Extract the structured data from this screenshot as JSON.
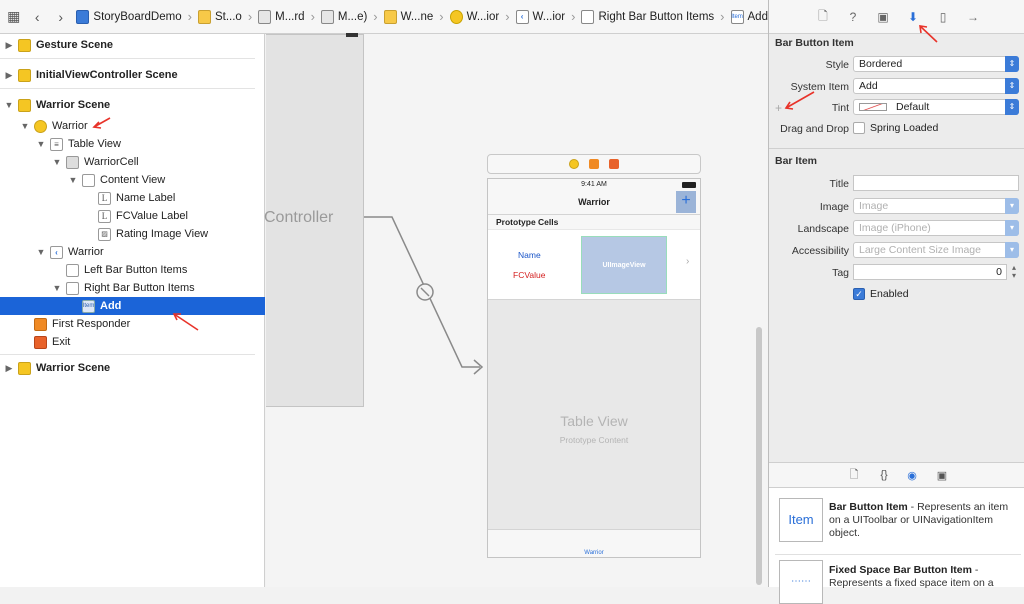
{
  "jumpbar": {
    "crumbs": [
      {
        "label": "StoryBoardDemo",
        "icon": "project-icon"
      },
      {
        "label": "St...o",
        "icon": "folder-icon"
      },
      {
        "label": "M...rd",
        "icon": "storyboard-icon"
      },
      {
        "label": "M...e)",
        "icon": "storyboard-icon"
      },
      {
        "label": "W...ne",
        "icon": "scene-icon"
      },
      {
        "label": "W...ior",
        "icon": "view-controller-icon"
      },
      {
        "label": "W...ior",
        "icon": "navigation-item-icon"
      },
      {
        "label": "Right Bar Button Items",
        "icon": "items-icon"
      },
      {
        "label": "Add",
        "icon": "bar-button-item-icon"
      }
    ]
  },
  "outline": {
    "rows": [
      {
        "label": "Gesture Scene",
        "bold": true
      },
      {
        "label": "InitialViewController Scene",
        "bold": true
      },
      {
        "label": "Warrior Scene",
        "bold": true
      },
      {
        "label": "Warrior"
      },
      {
        "label": "Table View"
      },
      {
        "label": "WarriorCell"
      },
      {
        "label": "Content View"
      },
      {
        "label": "Name Label"
      },
      {
        "label": "FCValue Label"
      },
      {
        "label": "Rating Image View"
      },
      {
        "label": "Warrior"
      },
      {
        "label": "Left Bar Button Items"
      },
      {
        "label": "Right Bar Button Items"
      },
      {
        "label": "Add",
        "selected": true
      },
      {
        "label": "First Responder"
      },
      {
        "label": "Exit"
      },
      {
        "label": "Warrior Scene",
        "bold": true
      }
    ]
  },
  "canvas": {
    "left_vc_title": "Controller",
    "scene": {
      "time": "9:41 AM",
      "nav_title": "Warrior",
      "add_glyph": "+",
      "section_header": "Prototype Cells",
      "name_label": "Name",
      "fc_label": "FCValue",
      "image_view": "UIImageView",
      "table_title": "Table View",
      "table_subtitle": "Prototype Content",
      "tab_label": "Warrior"
    }
  },
  "inspector": {
    "bar_button_item": {
      "title": "Bar Button Item",
      "style_label": "Style",
      "style_value": "Bordered",
      "system_item_label": "System Item",
      "system_item_value": "Add",
      "tint_label": "Tint",
      "tint_value": "Default",
      "drag_drop_label": "Drag and Drop",
      "spring_loaded_label": "Spring Loaded"
    },
    "bar_item": {
      "title": "Bar Item",
      "title_label": "Title",
      "title_value": "",
      "image_label": "Image",
      "image_placeholder": "Image",
      "landscape_label": "Landscape",
      "landscape_placeholder": "Image (iPhone)",
      "accessibility_label": "Accessibility",
      "accessibility_placeholder": "Large Content Size Image",
      "tag_label": "Tag",
      "tag_value": "0",
      "enabled_label": "Enabled",
      "enabled": true
    },
    "library": [
      {
        "icon_text": "Item",
        "title": "Bar Button Item",
        "desc": " - Represents an item on a UIToolbar or UINavigationItem object."
      },
      {
        "icon_text": "",
        "title": "Fixed Space Bar Button Item",
        "desc": " - Represents a fixed space item on a"
      }
    ]
  },
  "colors": {
    "selection": "#1b64d8",
    "accent": "#3b7bd8",
    "annotation_arrow": "#e8332a"
  }
}
